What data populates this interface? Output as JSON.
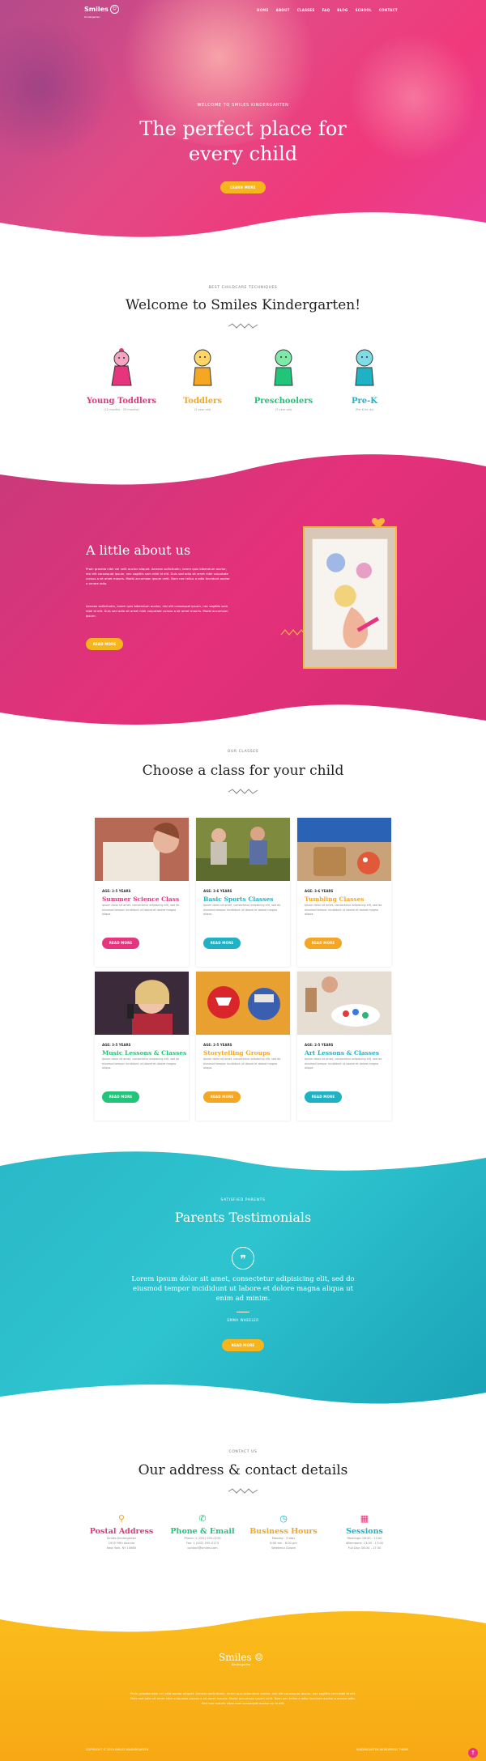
{
  "brand": {
    "name": "Smiles",
    "tagline": "Kindergarten",
    "mark": "☺"
  },
  "nav": [
    "HOME",
    "ABOUT",
    "CLASSES",
    "FAQ",
    "BLOG",
    "SCHOOL",
    "CONTACT"
  ],
  "hero": {
    "eyebrow": "WELCOME TO SMILES KINDERGARTEN",
    "title": "The perfect place for every child",
    "button": "LEARN MORE"
  },
  "welcome": {
    "eyebrow": "BEST CHILDCARE TECHNIQUES",
    "title": "Welcome to Smiles Kindergarten!",
    "groups": [
      {
        "label": "Young Toddlers",
        "sub": "(12 months - 25 months)",
        "color": "#e6357e"
      },
      {
        "label": "Toddlers",
        "sub": "(2 year old)",
        "color": "#f5a623"
      },
      {
        "label": "Preschoolers",
        "sub": "(3 year old)",
        "color": "#22c47a"
      },
      {
        "label": "Pre-K",
        "sub": "(Pre-K for 4s)",
        "color": "#1fb2c4"
      }
    ]
  },
  "about": {
    "title": "A little about us",
    "p1": "Proin gravida nibh vel velit auctor aliquet. Aenean sollicitudin, lorem quis bibendum auctor, nisi elit consequat ipsum, nec sagittis sem nibh id elit. Duis sed odio sit amet nibh vulputate cursus a sit amet mauris. Morbi accumsan ipsum velit. Nam nec tellus a odio tincidunt auctor a ornare odio.",
    "p2": "Aenean sollicitudin, lorem quis bibendum auctor, nisi elit consequat ipsum, nec sagittis sem nibh id elit. Duis sed odio sit amet nibh vulputate cursus a sit amet mauris. Morbi accumsan ipsum.",
    "button": "READ MORE"
  },
  "classes": {
    "eyebrow": "OUR CLASSES",
    "title": "Choose a class for your child",
    "items": [
      {
        "age": "AGE: 2-5 YEARS",
        "title": "Summer Science Class",
        "color": "#e6357e",
        "desc": "Ipsum dolor sit amet, consectetur adipiscing elit, sed do eiusmod tempor incididunt ut labore et dolore magna aliqua.",
        "button": "READ MORE"
      },
      {
        "age": "AGE: 3-6 YEARS",
        "title": "Basic Sports Classes",
        "color": "#1fb2c4",
        "desc": "Ipsum dolor sit amet, consectetur adipiscing elit, sed do eiusmod tempor incididunt ut labore et dolore magna aliqua.",
        "button": "READ MORE"
      },
      {
        "age": "AGE: 3-6 YEARS",
        "title": "Tumbling Classes",
        "color": "#f5a623",
        "desc": "Ipsum dolor sit amet, consectetur adipiscing elit, sed do eiusmod tempor incididunt ut labore et dolore magna aliqua.",
        "button": "READ MORE"
      },
      {
        "age": "AGE: 3-5 YEARS",
        "title": "Music Lessons & Classes",
        "color": "#22c47a",
        "desc": "Ipsum dolor sit amet, consectetur adipiscing elit, sed do eiusmod tempor incididunt ut labore et dolore magna aliqua.",
        "button": "READ MORE"
      },
      {
        "age": "AGE: 2-5 YEARS",
        "title": "Storytelling Groups",
        "color": "#f5a623",
        "desc": "Ipsum dolor sit amet, consectetur adipiscing elit, sed do eiusmod tempor incididunt ut labore et dolore magna aliqua.",
        "button": "READ MORE"
      },
      {
        "age": "AGE: 2-5 YEARS",
        "title": "Art Lessons & Classes",
        "color": "#1fb2c4",
        "desc": "Ipsum dolor sit amet, consectetur adipiscing elit, sed do eiusmod tempor incididunt ut labore et dolore magna aliqua.",
        "button": "READ MORE"
      }
    ]
  },
  "testimonials": {
    "eyebrow": "SATISFIED PARENTS",
    "title": "Parents Testimonials",
    "quote_mark": "❞",
    "text": "Lorem ipsum dolor sit amet, consectetur adipisicing elit, sed do eiusmod tempor incididunt ut labore et dolore magna aliqua ut enim ad minim.",
    "author": "EMMA WHEELER",
    "button": "READ MORE"
  },
  "contact": {
    "eyebrow": "CONTACT US",
    "title": "Our address & contact details",
    "items": [
      {
        "title": "Postal Address",
        "color": "#e6357e",
        "icon": "map-pin-icon",
        "glyph": "⚲",
        "lines": [
          "Smiles Kindergarten",
          "1915 Fifth Avenue",
          "New York, NY 10660"
        ]
      },
      {
        "title": "Phone & Email",
        "color": "#22c47a",
        "icon": "phone-icon",
        "glyph": "✆",
        "lines": [
          "Phone: 1 (202) 555-0193",
          "Fax: 1 (202) 555-0173",
          "contact@smiles.com"
        ]
      },
      {
        "title": "Business Hours",
        "color": "#f5a623",
        "icon": "clock-icon",
        "glyph": "◷",
        "lines": [
          "Monday - Friday",
          "8:00 am - 6:00 pm",
          "Weekend Closed"
        ]
      },
      {
        "title": "Sessions",
        "color": "#e6357e",
        "icon": "calendar-icon",
        "glyph": "▦",
        "lines": [
          "Mornings: 08:30 - 12:00",
          "Afternoons: 13:00 - 17:00",
          "Full Day: 08:30 - 17:30"
        ]
      }
    ]
  },
  "footer": {
    "text": "Proin gravida nibh vel velit auctor aliquet. Aenean sollicitudin, lorem quis bibendum auctor, nisi elit consequat ipsum, nec sagittis sem nibh id elit. Duis sed odio sit amet nibh vulputate cursus a sit amet mauris. Morbi accumsan ipsum velit. Nam nec tellus a odio tincidunt auctor a ornare odio. Sed non mauris vitae erat consequat auctor eu in elit.",
    "copyright": "COPYRIGHT © 2019 SMILES KINDERGARTEN",
    "right": "KINDERGARTEN WORDPRESS THEME",
    "totop": "↑"
  }
}
